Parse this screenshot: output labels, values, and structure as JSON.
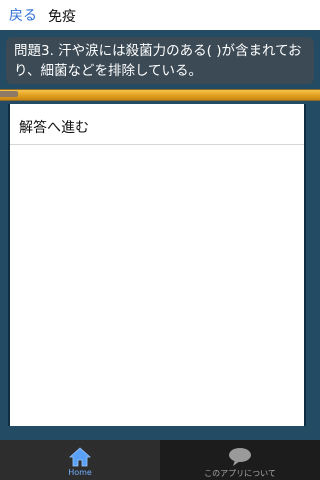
{
  "header": {
    "back_label": "戻る",
    "title": "免疫"
  },
  "question": {
    "text": "問題3. 汗や涙には殺菌力のある( )が含まれており、細菌などを排除している。"
  },
  "answer": {
    "button_label": "解答へ進む"
  },
  "tabbar": {
    "home_label": "Home",
    "about_label": "このアプリについて"
  },
  "colors": {
    "background": "#234b63",
    "accent": "#2f6fd6",
    "progress": "#e3a222",
    "active_tab": "#6fb0ff"
  },
  "icons": {
    "home": "home-icon",
    "about": "speech-bubble-icon"
  }
}
